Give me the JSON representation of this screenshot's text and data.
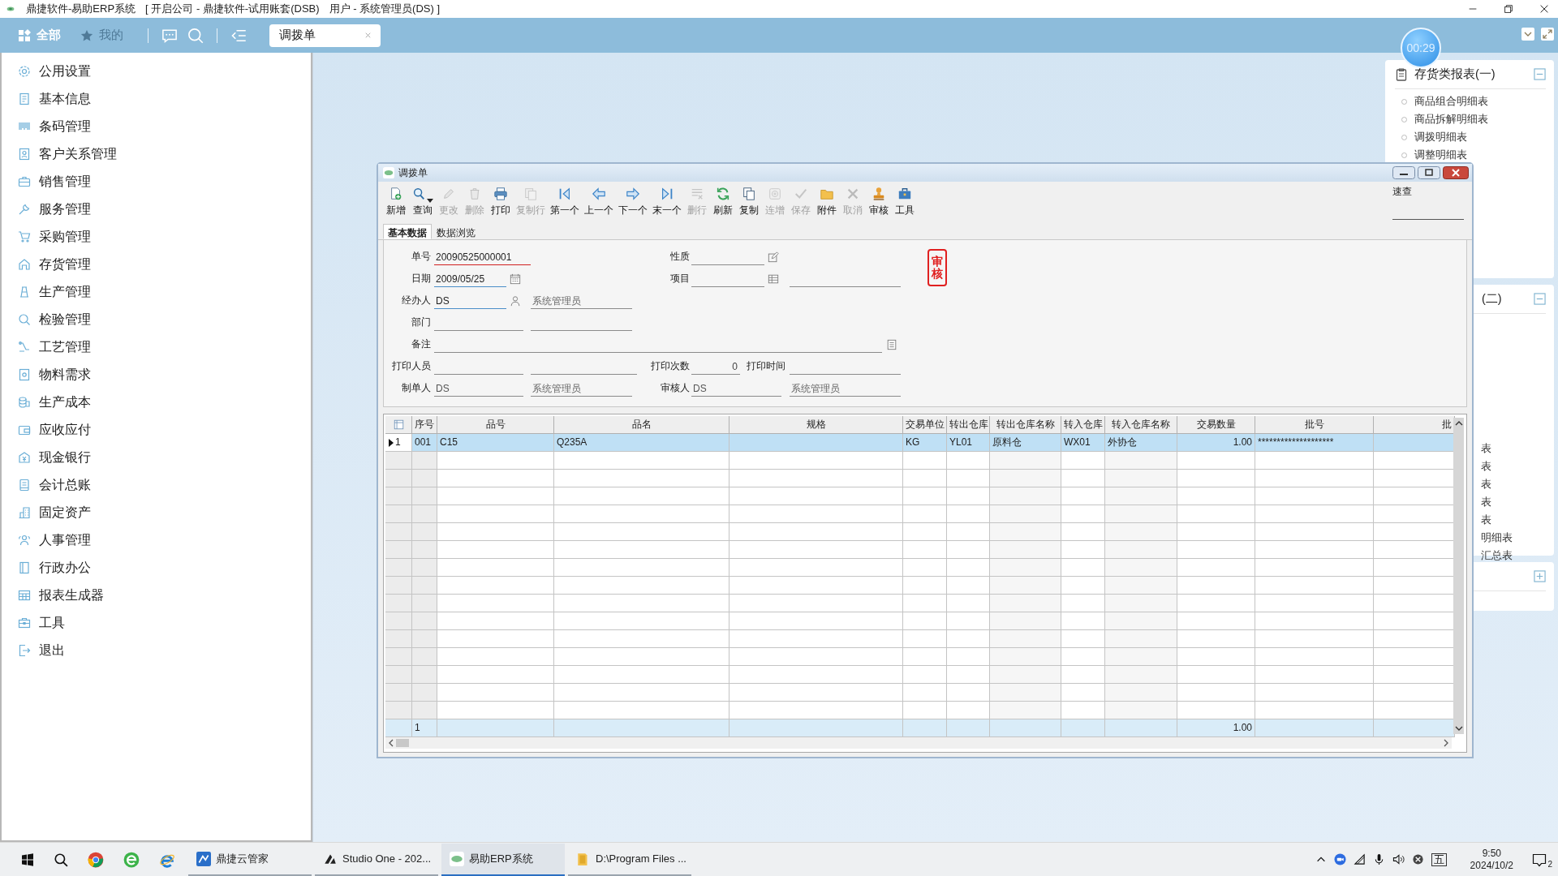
{
  "window": {
    "title": "鼎捷软件-易助ERP系统",
    "company": "[ 开启公司 - 鼎捷软件-试用账套(DSB)",
    "user": "用户 - 系统管理员(DS) ]"
  },
  "nav": [
    {
      "label": "全部",
      "disabled": false
    },
    {
      "label": "我的",
      "disabled": true
    }
  ],
  "tabs": [
    {
      "label": "调拨单",
      "selected": true
    }
  ],
  "timer": "00:29",
  "sidebar": {
    "items": [
      {
        "label": "公用设置"
      },
      {
        "label": "基本信息"
      },
      {
        "label": "条码管理"
      },
      {
        "label": "客户关系管理"
      },
      {
        "label": "销售管理"
      },
      {
        "label": "服务管理"
      },
      {
        "label": "采购管理"
      },
      {
        "label": "存货管理"
      },
      {
        "label": "生产管理"
      },
      {
        "label": "检验管理"
      },
      {
        "label": "工艺管理"
      },
      {
        "label": "物料需求"
      },
      {
        "label": "生产成本"
      },
      {
        "label": "应收应付"
      },
      {
        "label": "现金银行"
      },
      {
        "label": "会计总账"
      },
      {
        "label": "固定资产"
      },
      {
        "label": "人事管理"
      },
      {
        "label": "行政办公"
      },
      {
        "label": "报表生成器"
      },
      {
        "label": "工具"
      },
      {
        "label": "退出"
      }
    ]
  },
  "reports": [
    {
      "title": "存货类报表(一)",
      "expanded": true,
      "items": [
        "商品组合明细表",
        "商品拆解明细表",
        "调拨明细表",
        "调整明细表"
      ]
    },
    {
      "title": "(二)",
      "expanded": true,
      "items": [
        "表",
        "表",
        "表",
        "表",
        "表",
        "明细表",
        "汇总表"
      ]
    },
    {
      "expanded": false
    }
  ],
  "dialog": {
    "title": "调拨单",
    "toolbar": [
      {
        "label": "新增",
        "disabled": false
      },
      {
        "label": "查询",
        "disabled": false
      },
      {
        "label": "更改",
        "disabled": true
      },
      {
        "label": "删除",
        "disabled": true
      },
      {
        "label": "打印",
        "disabled": false
      },
      {
        "label": "复制行",
        "disabled": true
      },
      {
        "label": "第一个",
        "disabled": false
      },
      {
        "label": "上一个",
        "disabled": false
      },
      {
        "label": "下一个",
        "disabled": false
      },
      {
        "label": "末一个",
        "disabled": false
      },
      {
        "label": "删行",
        "disabled": true
      },
      {
        "label": "刷新",
        "disabled": false
      },
      {
        "label": "复制",
        "disabled": false
      },
      {
        "label": "连增",
        "disabled": true
      },
      {
        "label": "保存",
        "disabled": true
      },
      {
        "label": "附件",
        "disabled": false
      },
      {
        "label": "取消",
        "disabled": true
      },
      {
        "label": "审核",
        "disabled": false
      },
      {
        "label": "工具",
        "disabled": false
      }
    ],
    "quick_search": {
      "label": "速查"
    },
    "tabs": [
      {
        "label": "基本数据",
        "selected": true
      },
      {
        "label": "数据浏览",
        "selected": false
      }
    ],
    "form": {
      "doc_no": {
        "label": "单号",
        "value": "20090525000001"
      },
      "nature": {
        "label": "性质"
      },
      "date": {
        "label": "日期",
        "value": "2009/05/25"
      },
      "project": {
        "label": "项目"
      },
      "handler": {
        "label": "经办人",
        "value": "DS",
        "name": "系统管理员"
      },
      "department": {
        "label": "部门"
      },
      "remark": {
        "label": "备注"
      },
      "printer": {
        "label": "打印人员"
      },
      "print_count": {
        "label": "打印次数",
        "value": "0"
      },
      "print_time": {
        "label": "打印时间"
      },
      "creator": {
        "label": "制单人",
        "value": "DS",
        "name": "系统管理员"
      },
      "approver": {
        "label": "审核人",
        "value": "DS",
        "name": "系统管理员"
      },
      "stamp": "审核"
    },
    "grid": {
      "columns": [
        {
          "label": "序号"
        },
        {
          "label": "品号"
        },
        {
          "label": "品名"
        },
        {
          "label": "规格"
        },
        {
          "label": "交易单位"
        },
        {
          "label": "转出仓库"
        },
        {
          "label": "转出仓库名称"
        },
        {
          "label": "转入仓库"
        },
        {
          "label": "转入仓库名称"
        },
        {
          "label": "交易数量",
          "kind": "number"
        },
        {
          "label": "批号"
        },
        {
          "label": "批"
        }
      ],
      "rows": [
        {
          "row_no": "1",
          "selected": true,
          "cells": [
            "001",
            "C15",
            "Q235A",
            null,
            "KG",
            "YL01",
            "原料仓",
            "WX01",
            "外协仓",
            "1.00",
            "********************",
            null
          ]
        }
      ],
      "footer": {
        "row_count": "1",
        "total": "1.00"
      }
    }
  },
  "taskbar": {
    "apps": [
      {
        "label": "鼎捷云管家",
        "active": false
      },
      {
        "label": "Studio One - 202...",
        "active": false
      },
      {
        "label": "易助ERP系统",
        "active": true
      },
      {
        "label": "D:\\Program Files ...",
        "active": false
      }
    ],
    "ime": "五",
    "time": "9:50",
    "date": "2024/10/2",
    "notifications": "2"
  }
}
